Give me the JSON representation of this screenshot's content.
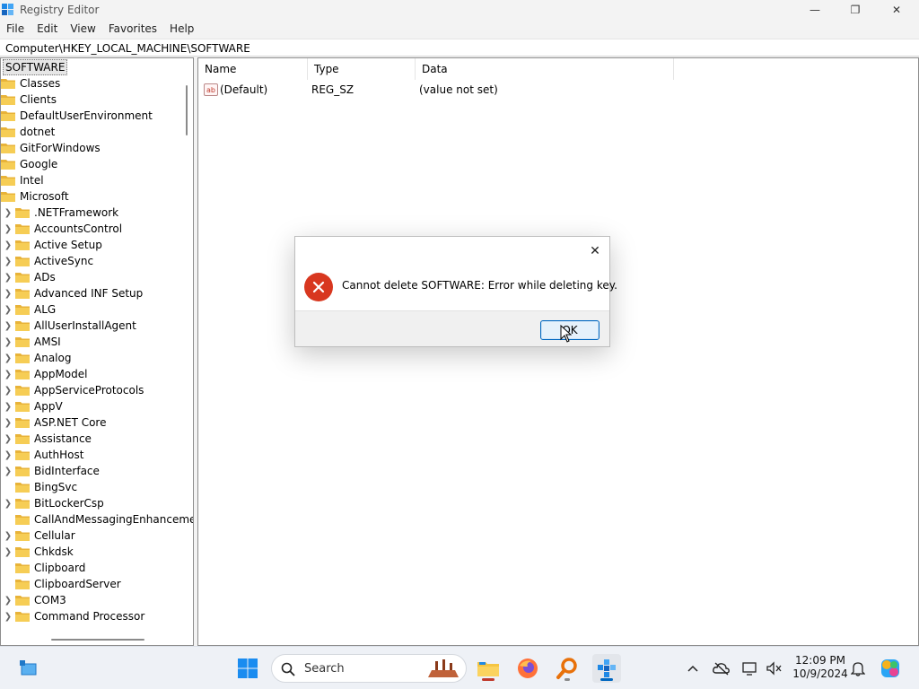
{
  "window": {
    "title": "Registry Editor",
    "minimize_glyph": "—",
    "restore_glyph": "❐",
    "close_glyph": "✕"
  },
  "menu": [
    "File",
    "Edit",
    "View",
    "Favorites",
    "Help"
  ],
  "address": "Computer\\HKEY_LOCAL_MACHINE\\SOFTWARE",
  "tree": {
    "root": "SOFTWARE",
    "children": [
      "Classes",
      "Clients",
      "DefaultUserEnvironment",
      "dotnet",
      "GitForWindows",
      "Google",
      "Intel",
      "Microsoft"
    ],
    "microsoft_children": [
      {
        "name": ".NETFramework",
        "expandable": true
      },
      {
        "name": "AccountsControl",
        "expandable": true
      },
      {
        "name": "Active Setup",
        "expandable": true
      },
      {
        "name": "ActiveSync",
        "expandable": true
      },
      {
        "name": "ADs",
        "expandable": true
      },
      {
        "name": "Advanced INF Setup",
        "expandable": true
      },
      {
        "name": "ALG",
        "expandable": true
      },
      {
        "name": "AllUserInstallAgent",
        "expandable": true
      },
      {
        "name": "AMSI",
        "expandable": true
      },
      {
        "name": "Analog",
        "expandable": true
      },
      {
        "name": "AppModel",
        "expandable": true
      },
      {
        "name": "AppServiceProtocols",
        "expandable": true
      },
      {
        "name": "AppV",
        "expandable": true
      },
      {
        "name": "ASP.NET Core",
        "expandable": true
      },
      {
        "name": "Assistance",
        "expandable": true
      },
      {
        "name": "AuthHost",
        "expandable": true
      },
      {
        "name": "BidInterface",
        "expandable": true
      },
      {
        "name": "BingSvc",
        "expandable": false
      },
      {
        "name": "BitLockerCsp",
        "expandable": true
      },
      {
        "name": "CallAndMessagingEnhanceme",
        "expandable": false
      },
      {
        "name": "Cellular",
        "expandable": true
      },
      {
        "name": "Chkdsk",
        "expandable": true
      },
      {
        "name": "Clipboard",
        "expandable": false
      },
      {
        "name": "ClipboardServer",
        "expandable": false
      },
      {
        "name": "COM3",
        "expandable": true
      },
      {
        "name": "Command Processor",
        "expandable": true
      }
    ]
  },
  "list": {
    "columns": [
      "Name",
      "Type",
      "Data"
    ],
    "rows": [
      {
        "name": "(Default)",
        "type": "REG_SZ",
        "data": "(value not set)",
        "icon": "string-value-icon",
        "icon_text": "ab"
      }
    ]
  },
  "dialog": {
    "message": "Cannot delete SOFTWARE:  Error while deleting key.",
    "ok_label": "OK",
    "icon": "error-icon",
    "close_glyph": "✕"
  },
  "taskbar": {
    "search_placeholder": "Search",
    "time": "12:09 PM",
    "date": "10/9/2024"
  },
  "colors": {
    "folder": "#f2c14e",
    "error": "#d8371f",
    "accent": "#0067c0"
  }
}
